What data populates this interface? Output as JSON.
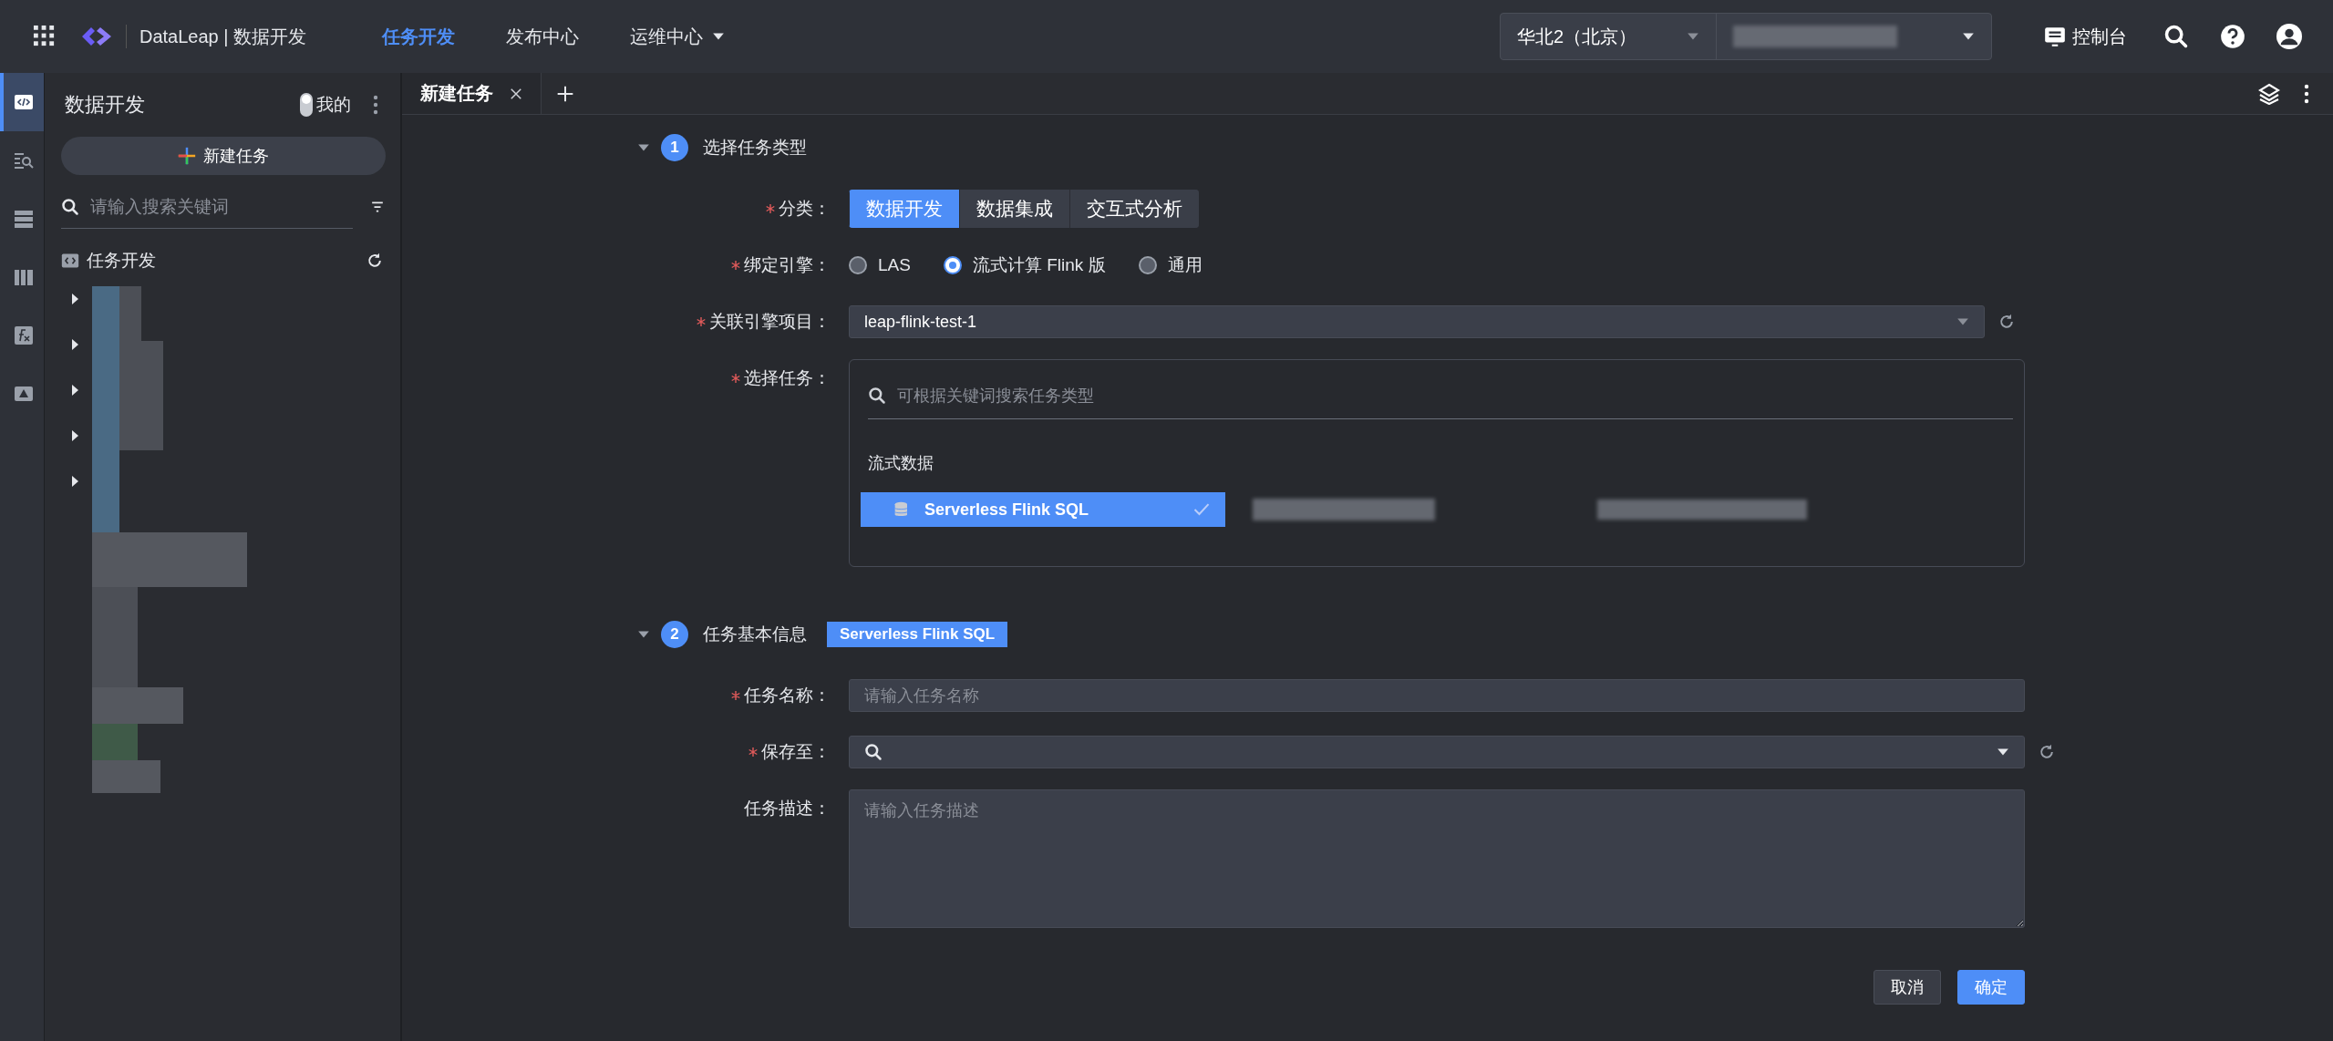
{
  "top_bar": {
    "app_title": "DataLeap | 数据开发",
    "nav": [
      {
        "label": "任务开发",
        "selected": true,
        "has_menu": false
      },
      {
        "label": "发布中心",
        "selected": false,
        "has_menu": false
      },
      {
        "label": "运维中心",
        "selected": false,
        "has_menu": true
      }
    ],
    "region": "华北2（北京）",
    "console": "控制台"
  },
  "rail": [
    {
      "selected": true
    },
    {
      "selected": false
    },
    {
      "selected": false
    },
    {
      "selected": false
    },
    {
      "selected": false
    },
    {
      "selected": false
    }
  ],
  "sidebar": {
    "title": "数据开发",
    "mine": {
      "label": "我的",
      "on": false
    },
    "new_task": "新建任务",
    "search_placeholder": "请输入搜索关键词",
    "tree_root": "任务开发"
  },
  "tabs": [
    {
      "label": "新建任务",
      "selected": true
    }
  ],
  "step1": {
    "number": "1",
    "title": "选择任务类型",
    "expanded": true,
    "category": {
      "label": "分类：",
      "required": true,
      "options": [
        {
          "label": "数据开发",
          "selected": true
        },
        {
          "label": "数据集成",
          "selected": false
        },
        {
          "label": "交互式分析",
          "selected": false
        }
      ]
    },
    "engine": {
      "label": "绑定引擎：",
      "required": true,
      "options": [
        {
          "label": "LAS",
          "selected": false
        },
        {
          "label": "流式计算 Flink 版",
          "selected": true
        },
        {
          "label": "通用",
          "selected": false
        }
      ]
    },
    "project": {
      "label": "关联引擎项目：",
      "required": true,
      "value": "leap-flink-test-1"
    },
    "task": {
      "label": "选择任务：",
      "required": true,
      "search_placeholder": "可根据关键词搜索任务类型",
      "group": "流式数据",
      "items": [
        {
          "label": "Serverless Flink SQL",
          "selected": true
        }
      ]
    }
  },
  "step2": {
    "number": "2",
    "title": "任务基本信息",
    "expanded": true,
    "tag": "Serverless Flink SQL",
    "name": {
      "label": "任务名称：",
      "required": true,
      "placeholder": "请输入任务名称"
    },
    "save_to": {
      "label": "保存至：",
      "required": true
    },
    "description": {
      "label": "任务描述：",
      "required": false,
      "placeholder": "请输入任务描述"
    }
  },
  "buttons": [
    {
      "label": "取消",
      "kind": "secondary"
    },
    {
      "label": "确定",
      "kind": "primary"
    }
  ]
}
